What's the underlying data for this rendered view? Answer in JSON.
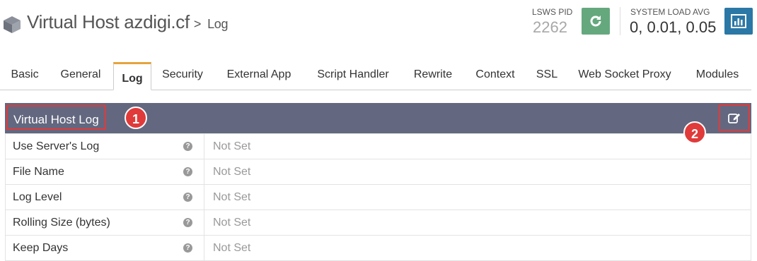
{
  "header": {
    "title": "Virtual Host azdigi.cf",
    "separator": ">",
    "subtitle": "Log",
    "pid_label": "LSWS PID",
    "pid_value": "2262",
    "load_label": "SYSTEM LOAD AVG",
    "load_value": "0, 0.01, 0.05",
    "icons": {
      "logo": "cube-icon",
      "restart": "refresh-icon",
      "stats": "bar-chart-icon"
    },
    "colors": {
      "restart_bg": "#65a87e",
      "stats_bg": "#2b78a6"
    }
  },
  "tabs": [
    {
      "label": "Basic"
    },
    {
      "label": "General"
    },
    {
      "label": "Log",
      "active": true
    },
    {
      "label": "Security"
    },
    {
      "label": "External App"
    },
    {
      "label": "Script Handler"
    },
    {
      "label": "Rewrite"
    },
    {
      "label": "Context"
    },
    {
      "label": "SSL"
    },
    {
      "label": "Web Socket Proxy"
    },
    {
      "label": "Modules"
    }
  ],
  "panel": {
    "title": "Virtual Host Log",
    "badge_1": "1",
    "badge_2": "2",
    "header_color": "#636880",
    "highlight_color": "#e03a3a",
    "edit_icon": "edit-icon",
    "rows": [
      {
        "label": "Use Server's Log",
        "value": "Not Set"
      },
      {
        "label": "File Name",
        "value": "Not Set"
      },
      {
        "label": "Log Level",
        "value": "Not Set"
      },
      {
        "label": "Rolling Size (bytes)",
        "value": "Not Set"
      },
      {
        "label": "Keep Days",
        "value": "Not Set"
      }
    ],
    "help_glyph": "?"
  },
  "accent": "#e6a33c"
}
